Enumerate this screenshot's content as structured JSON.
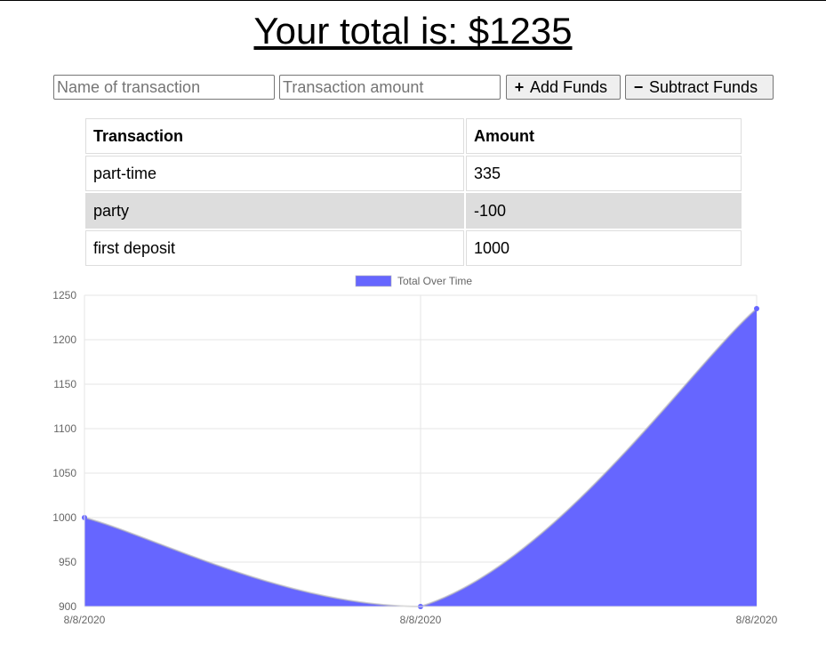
{
  "header": {
    "total_text": "Your total is: $1235"
  },
  "form": {
    "name_placeholder": "Name of transaction",
    "amount_placeholder": "Transaction amount",
    "add_label": "Add Funds",
    "add_icon": "plus-icon",
    "subtract_label": "Subtract Funds",
    "subtract_icon": "minus-icon"
  },
  "table": {
    "headers": [
      "Transaction",
      "Amount"
    ],
    "rows": [
      {
        "name": "part-time",
        "amount": "335"
      },
      {
        "name": "party",
        "amount": "-100"
      },
      {
        "name": "first deposit",
        "amount": "1000"
      }
    ]
  },
  "chart_data": {
    "type": "area",
    "x": [
      "8/8/2020",
      "8/8/2020",
      "8/8/2020"
    ],
    "series": [
      {
        "name": "Total Over Time",
        "values": [
          1000,
          900,
          1235
        ],
        "color": "#6666ff"
      }
    ],
    "ylim": [
      900,
      1250
    ],
    "yticks": [
      900,
      950,
      1000,
      1050,
      1100,
      1150,
      1200,
      1250
    ],
    "grid": true,
    "legend_position": "top"
  }
}
